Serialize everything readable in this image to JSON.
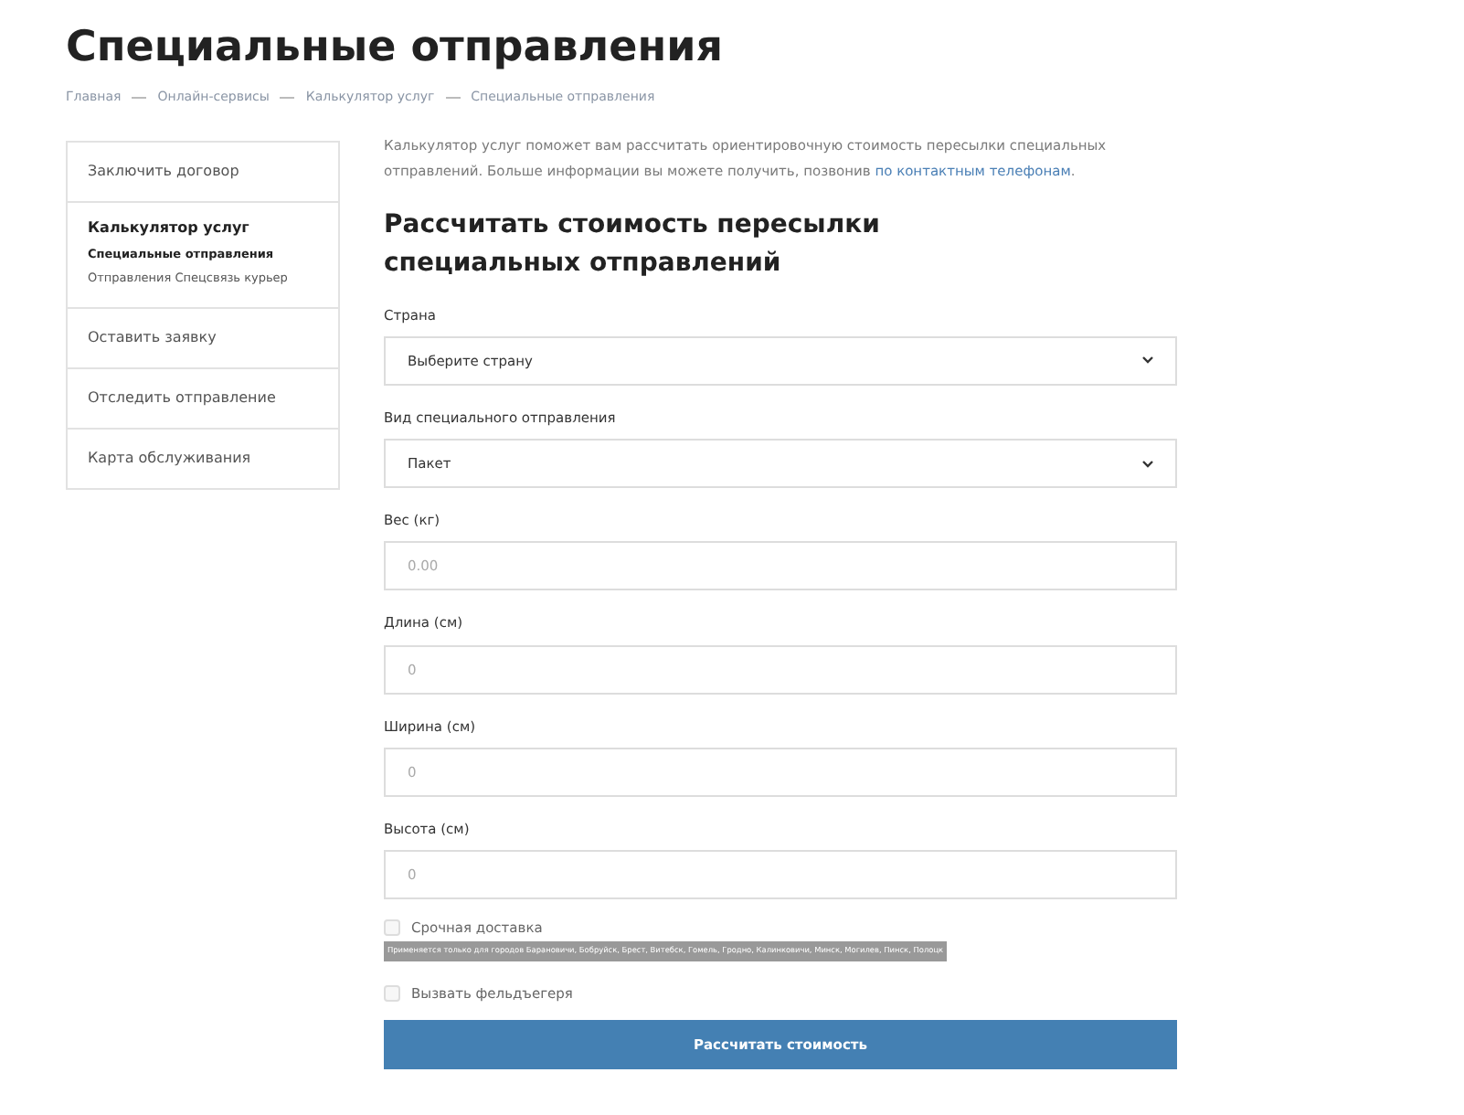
{
  "title": "Специальные отправления",
  "breadcrumbs": [
    "Главная",
    "Онлайн-сервисы",
    "Калькулятор услуг",
    "Специальные отправления"
  ],
  "sidebar": {
    "items": [
      {
        "label": "Заключить договор",
        "expanded": false
      },
      {
        "label": "Калькулятор услуг",
        "expanded": true,
        "children": [
          {
            "label": "Специальные отправления",
            "selected": true
          },
          {
            "label": "Отправления Спецсвязь курьер",
            "selected": false
          }
        ]
      },
      {
        "label": "Оставить заявку",
        "expanded": false
      },
      {
        "label": "Отследить отправление",
        "expanded": false
      },
      {
        "label": "Карта обслуживания",
        "expanded": false
      }
    ]
  },
  "intro": {
    "text": "Калькулятор услуг поможет вам рассчитать ориентировочную стоимость пересылки специальных отправлений. Больше информации вы можете получить, позвонив ",
    "link": "по контактным телефонам",
    "end": "."
  },
  "form_title": "Рассчитать стоимость пересылки специальных отправлений",
  "fields": [
    {
      "kind": "select",
      "label": "Страна",
      "value": "Выберите страну"
    },
    {
      "kind": "select",
      "label": "Вид специального отправления",
      "value": "Пакет"
    },
    {
      "kind": "input",
      "label": "Вес (кг)",
      "placeholder": "0.00"
    },
    {
      "kind": "input",
      "label": "Длина (см)",
      "placeholder": "0"
    },
    {
      "kind": "input",
      "label": "Ширина (см)",
      "placeholder": "0"
    },
    {
      "kind": "input",
      "label": "Высота (см)",
      "placeholder": "0"
    }
  ],
  "checkboxes": [
    {
      "label": "Срочная доставка",
      "checked": false,
      "note": "Применяется только для городов Барановичи, Бобруйск, Брест, Витебск, Гомель, Гродно, Калинковичи, Минск, Могилев, Пинск, Полоцк"
    },
    {
      "label": "Вызвать фельдъегеря",
      "checked": false
    }
  ],
  "submit": "Рассчитать стоимость"
}
